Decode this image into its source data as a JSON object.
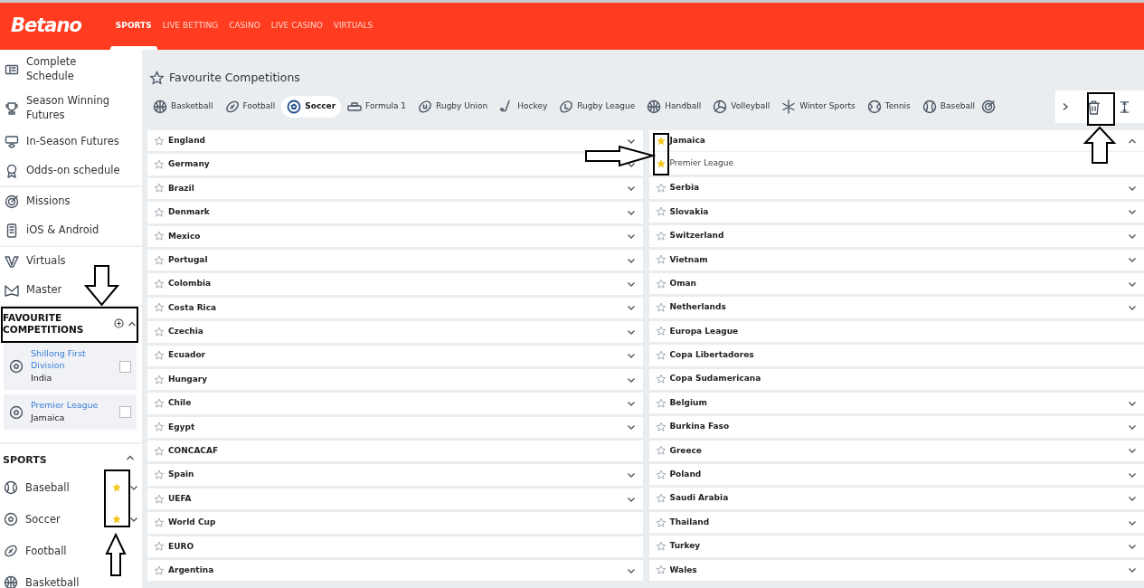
{
  "header": {
    "logo": "Betano",
    "nav": [
      {
        "label": "SPORTS",
        "selected": true
      },
      {
        "label": "LIVE BETTING",
        "selected": false
      },
      {
        "label": "CASINO",
        "selected": false
      },
      {
        "label": "LIVE CASINO",
        "selected": false
      },
      {
        "label": "VIRTUALS",
        "selected": false
      }
    ]
  },
  "sidebar": {
    "menu_groups": [
      [
        "Complete Schedule",
        "Season Winning Futures",
        "In-Season Futures",
        "Odds-on schedule"
      ],
      [
        "Missions",
        "iOS & Android"
      ],
      [
        "Virtuals",
        "Master"
      ]
    ],
    "favourite_competitions": {
      "title": "FAVOURITE COMPETITIONS",
      "expanded": true,
      "items": [
        {
          "name": "Shillong First Division",
          "country": "India",
          "checked": false
        },
        {
          "name": "Premier League",
          "country": "Jamaica",
          "checked": false
        }
      ]
    },
    "sports": {
      "title": "SPORTS",
      "expanded": true,
      "items": [
        {
          "name": "Baseball",
          "favourite": true,
          "expanded": false
        },
        {
          "name": "Soccer",
          "favourite": true,
          "expanded": false
        },
        {
          "name": "Football",
          "favourite": false
        },
        {
          "name": "Basketball",
          "favourite": false
        }
      ]
    }
  },
  "main": {
    "title": "Favourite Competitions",
    "sport_tabs": [
      {
        "label": "Basketball",
        "selected": false
      },
      {
        "label": "Football",
        "selected": false
      },
      {
        "label": "Soccer",
        "selected": true
      },
      {
        "label": "Formula 1",
        "selected": false
      },
      {
        "label": "Rugby Union",
        "selected": false
      },
      {
        "label": "Hockey",
        "selected": false
      },
      {
        "label": "Rugby League",
        "selected": false
      },
      {
        "label": "Handball",
        "selected": false
      },
      {
        "label": "Volleyball",
        "selected": false
      },
      {
        "label": "Winter Sports",
        "selected": false
      },
      {
        "label": "Tennis",
        "selected": false
      },
      {
        "label": "Baseball",
        "selected": false
      }
    ],
    "columns": [
      [
        {
          "name": "England",
          "favourite": false,
          "expanded": false
        },
        {
          "name": "Germany",
          "favourite": false,
          "expanded": false
        },
        {
          "name": "Brazil",
          "favourite": false,
          "expanded": false
        },
        {
          "name": "Denmark",
          "favourite": false,
          "expanded": false
        },
        {
          "name": "Mexico",
          "favourite": false,
          "expanded": false
        },
        {
          "name": "Portugal",
          "favourite": false,
          "expanded": false
        },
        {
          "name": "Colombia",
          "favourite": false,
          "expanded": false
        },
        {
          "name": "Costa Rica",
          "favourite": false,
          "expanded": false
        },
        {
          "name": "Czechia",
          "favourite": false,
          "expanded": false
        },
        {
          "name": "Ecuador",
          "favourite": false,
          "expanded": false
        },
        {
          "name": "Hungary",
          "favourite": false,
          "expanded": false
        },
        {
          "name": "Chile",
          "favourite": false,
          "expanded": false
        },
        {
          "name": "Egypt",
          "favourite": false,
          "expanded": false
        },
        {
          "name": "CONCACAF",
          "favourite": false
        },
        {
          "name": "Spain",
          "favourite": false,
          "expanded": false
        },
        {
          "name": "UEFA",
          "favourite": false,
          "expanded": false
        },
        {
          "name": "World Cup",
          "favourite": false
        },
        {
          "name": "EURO",
          "favourite": false
        },
        {
          "name": "Argentina",
          "favourite": false,
          "expanded": false
        }
      ],
      [
        {
          "name": "Jamaica",
          "favourite": true,
          "expanded": true,
          "children": [
            {
              "name": "Premier League",
              "favourite": true
            }
          ]
        },
        {
          "name": "Serbia",
          "favourite": false,
          "expanded": false
        },
        {
          "name": "Slovakia",
          "favourite": false,
          "expanded": false
        },
        {
          "name": "Switzerland",
          "favourite": false,
          "expanded": false
        },
        {
          "name": "Vietnam",
          "favourite": false,
          "expanded": false
        },
        {
          "name": "Oman",
          "favourite": false,
          "expanded": false
        },
        {
          "name": "Netherlands",
          "favourite": false,
          "expanded": false
        },
        {
          "name": "Europa League",
          "favourite": false
        },
        {
          "name": "Copa Libertadores",
          "favourite": false
        },
        {
          "name": "Copa Sudamericana",
          "favourite": false
        },
        {
          "name": "Belgium",
          "favourite": false,
          "expanded": false
        },
        {
          "name": "Burkina Faso",
          "favourite": false,
          "expanded": false
        },
        {
          "name": "Greece",
          "favourite": false,
          "expanded": false
        },
        {
          "name": "Poland",
          "favourite": false,
          "expanded": false
        },
        {
          "name": "Saudi Arabia",
          "favourite": false,
          "expanded": false
        },
        {
          "name": "Thailand",
          "favourite": false,
          "expanded": false
        },
        {
          "name": "Turkey",
          "favourite": false,
          "expanded": false
        },
        {
          "name": "Wales",
          "favourite": false,
          "expanded": false
        }
      ]
    ]
  }
}
